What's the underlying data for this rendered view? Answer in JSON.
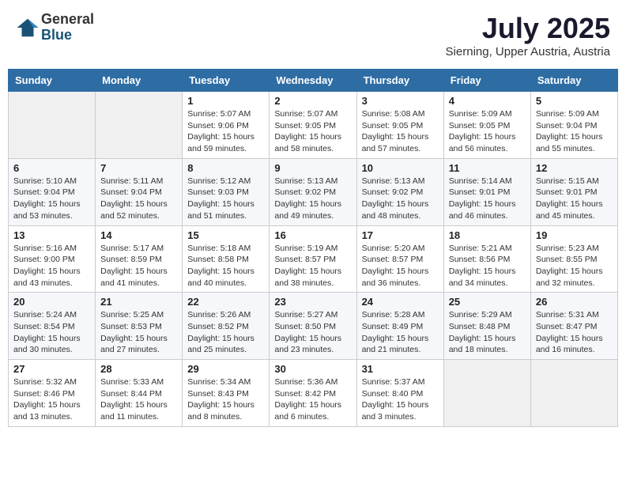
{
  "header": {
    "logo_general": "General",
    "logo_blue": "Blue",
    "month_year": "July 2025",
    "location": "Sierning, Upper Austria, Austria"
  },
  "weekdays": [
    "Sunday",
    "Monday",
    "Tuesday",
    "Wednesday",
    "Thursday",
    "Friday",
    "Saturday"
  ],
  "weeks": [
    [
      {
        "day": "",
        "info": ""
      },
      {
        "day": "",
        "info": ""
      },
      {
        "day": "1",
        "info": "Sunrise: 5:07 AM\nSunset: 9:06 PM\nDaylight: 15 hours and 59 minutes."
      },
      {
        "day": "2",
        "info": "Sunrise: 5:07 AM\nSunset: 9:05 PM\nDaylight: 15 hours and 58 minutes."
      },
      {
        "day": "3",
        "info": "Sunrise: 5:08 AM\nSunset: 9:05 PM\nDaylight: 15 hours and 57 minutes."
      },
      {
        "day": "4",
        "info": "Sunrise: 5:09 AM\nSunset: 9:05 PM\nDaylight: 15 hours and 56 minutes."
      },
      {
        "day": "5",
        "info": "Sunrise: 5:09 AM\nSunset: 9:04 PM\nDaylight: 15 hours and 55 minutes."
      }
    ],
    [
      {
        "day": "6",
        "info": "Sunrise: 5:10 AM\nSunset: 9:04 PM\nDaylight: 15 hours and 53 minutes."
      },
      {
        "day": "7",
        "info": "Sunrise: 5:11 AM\nSunset: 9:04 PM\nDaylight: 15 hours and 52 minutes."
      },
      {
        "day": "8",
        "info": "Sunrise: 5:12 AM\nSunset: 9:03 PM\nDaylight: 15 hours and 51 minutes."
      },
      {
        "day": "9",
        "info": "Sunrise: 5:13 AM\nSunset: 9:02 PM\nDaylight: 15 hours and 49 minutes."
      },
      {
        "day": "10",
        "info": "Sunrise: 5:13 AM\nSunset: 9:02 PM\nDaylight: 15 hours and 48 minutes."
      },
      {
        "day": "11",
        "info": "Sunrise: 5:14 AM\nSunset: 9:01 PM\nDaylight: 15 hours and 46 minutes."
      },
      {
        "day": "12",
        "info": "Sunrise: 5:15 AM\nSunset: 9:01 PM\nDaylight: 15 hours and 45 minutes."
      }
    ],
    [
      {
        "day": "13",
        "info": "Sunrise: 5:16 AM\nSunset: 9:00 PM\nDaylight: 15 hours and 43 minutes."
      },
      {
        "day": "14",
        "info": "Sunrise: 5:17 AM\nSunset: 8:59 PM\nDaylight: 15 hours and 41 minutes."
      },
      {
        "day": "15",
        "info": "Sunrise: 5:18 AM\nSunset: 8:58 PM\nDaylight: 15 hours and 40 minutes."
      },
      {
        "day": "16",
        "info": "Sunrise: 5:19 AM\nSunset: 8:57 PM\nDaylight: 15 hours and 38 minutes."
      },
      {
        "day": "17",
        "info": "Sunrise: 5:20 AM\nSunset: 8:57 PM\nDaylight: 15 hours and 36 minutes."
      },
      {
        "day": "18",
        "info": "Sunrise: 5:21 AM\nSunset: 8:56 PM\nDaylight: 15 hours and 34 minutes."
      },
      {
        "day": "19",
        "info": "Sunrise: 5:23 AM\nSunset: 8:55 PM\nDaylight: 15 hours and 32 minutes."
      }
    ],
    [
      {
        "day": "20",
        "info": "Sunrise: 5:24 AM\nSunset: 8:54 PM\nDaylight: 15 hours and 30 minutes."
      },
      {
        "day": "21",
        "info": "Sunrise: 5:25 AM\nSunset: 8:53 PM\nDaylight: 15 hours and 27 minutes."
      },
      {
        "day": "22",
        "info": "Sunrise: 5:26 AM\nSunset: 8:52 PM\nDaylight: 15 hours and 25 minutes."
      },
      {
        "day": "23",
        "info": "Sunrise: 5:27 AM\nSunset: 8:50 PM\nDaylight: 15 hours and 23 minutes."
      },
      {
        "day": "24",
        "info": "Sunrise: 5:28 AM\nSunset: 8:49 PM\nDaylight: 15 hours and 21 minutes."
      },
      {
        "day": "25",
        "info": "Sunrise: 5:29 AM\nSunset: 8:48 PM\nDaylight: 15 hours and 18 minutes."
      },
      {
        "day": "26",
        "info": "Sunrise: 5:31 AM\nSunset: 8:47 PM\nDaylight: 15 hours and 16 minutes."
      }
    ],
    [
      {
        "day": "27",
        "info": "Sunrise: 5:32 AM\nSunset: 8:46 PM\nDaylight: 15 hours and 13 minutes."
      },
      {
        "day": "28",
        "info": "Sunrise: 5:33 AM\nSunset: 8:44 PM\nDaylight: 15 hours and 11 minutes."
      },
      {
        "day": "29",
        "info": "Sunrise: 5:34 AM\nSunset: 8:43 PM\nDaylight: 15 hours and 8 minutes."
      },
      {
        "day": "30",
        "info": "Sunrise: 5:36 AM\nSunset: 8:42 PM\nDaylight: 15 hours and 6 minutes."
      },
      {
        "day": "31",
        "info": "Sunrise: 5:37 AM\nSunset: 8:40 PM\nDaylight: 15 hours and 3 minutes."
      },
      {
        "day": "",
        "info": ""
      },
      {
        "day": "",
        "info": ""
      }
    ]
  ]
}
